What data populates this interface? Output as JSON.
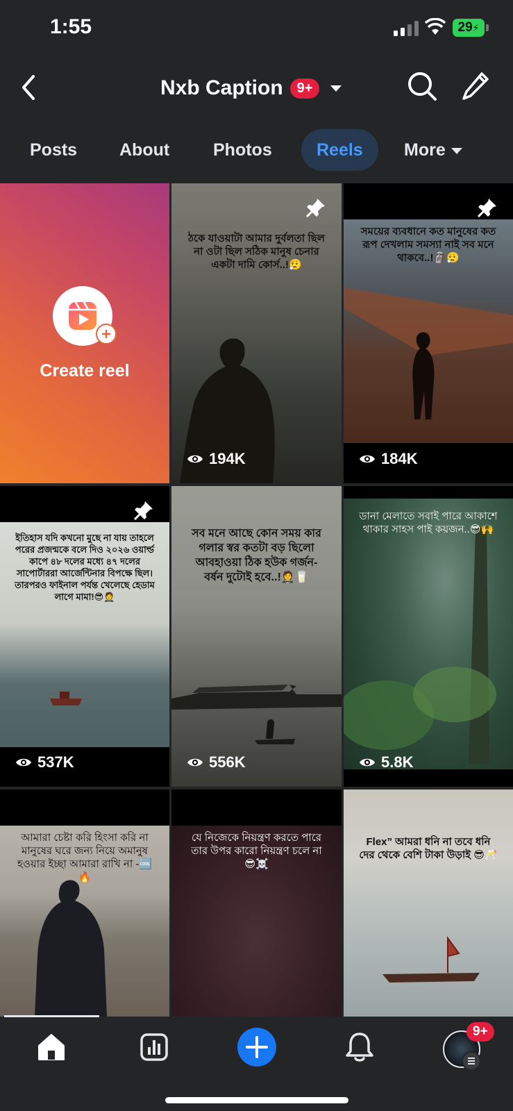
{
  "status_bar": {
    "time": "1:55",
    "battery": "29"
  },
  "header": {
    "title": "Nxb Caption",
    "badge": "9+"
  },
  "tabs": [
    {
      "label": "Posts"
    },
    {
      "label": "About"
    },
    {
      "label": "Photos"
    },
    {
      "label": "Reels",
      "active": true
    },
    {
      "label": "More"
    }
  ],
  "create_reel": {
    "label": "Create reel"
  },
  "reels": [
    {
      "caption": "ঠকে যাওয়াটা আমার দুর্বলতা ছিল না ওটা ছিল সঠিক মানুষ চেনার একটা দামি কোর্স..!😮‍💨",
      "views": "194K",
      "pinned": true
    },
    {
      "caption": "সময়ের ব্যবধানে কত মানুষের কত রূপ দেখলাম সমস্যা নাই সব মনে থাকবে..!🗿😮‍💨",
      "views": "184K",
      "pinned": true
    },
    {
      "caption": "ইতিহাস যদি কখনো মুছে না যায় তাহলে পরের প্রজন্মকে বলে দিও ২০২৬ ওয়ার্ল্ড কাপে ৪৮ দলের মধ্যে ৪৭ দলের সাপোর্টাররা আর্জেন্টিনার বিপক্ষে ছিল। তারপরও ফাইনাল পর্যন্ত খেলেছে হেডাম লাগে মামা!😎🤵",
      "views": "537K",
      "pinned": true
    },
    {
      "caption": "সব মনে আছে কোন সময় কার গলার স্বর কতটা বড় ছিলো আবহাওয়া ঠিক হউক গর্জন- বর্ষন দুটোই হবে..!🤵🥛",
      "views": "556K",
      "pinned": false
    },
    {
      "caption": "ডানা মেলাতে সবাই পারে আকাশে থাকার সাহস পাই কয়জন..😎🙌",
      "views": "5.8K",
      "pinned": false
    },
    {
      "caption": "আমারা চেষ্টা করি হিংসা করি না মানুষের ঘরে জন্য নিয়ে অমানুষ হওয়ার ইচ্ছা আমারা রাখি না -🆒🔥",
      "views": "",
      "pinned": false
    },
    {
      "caption": "যে নিজেকে নিয়ন্ত্রণ করতে পারে তার উপর কারো নিয়ন্ত্রণ চলে না 😎☠️",
      "views": "",
      "pinned": false
    },
    {
      "caption": "Flex” আমরা ধনি না তবে ধনি দের থেকে বেশি টাকা উড়াই 😎🥂",
      "views": "",
      "pinned": false
    }
  ],
  "bottom_nav": {
    "notifications_badge": "9+"
  }
}
